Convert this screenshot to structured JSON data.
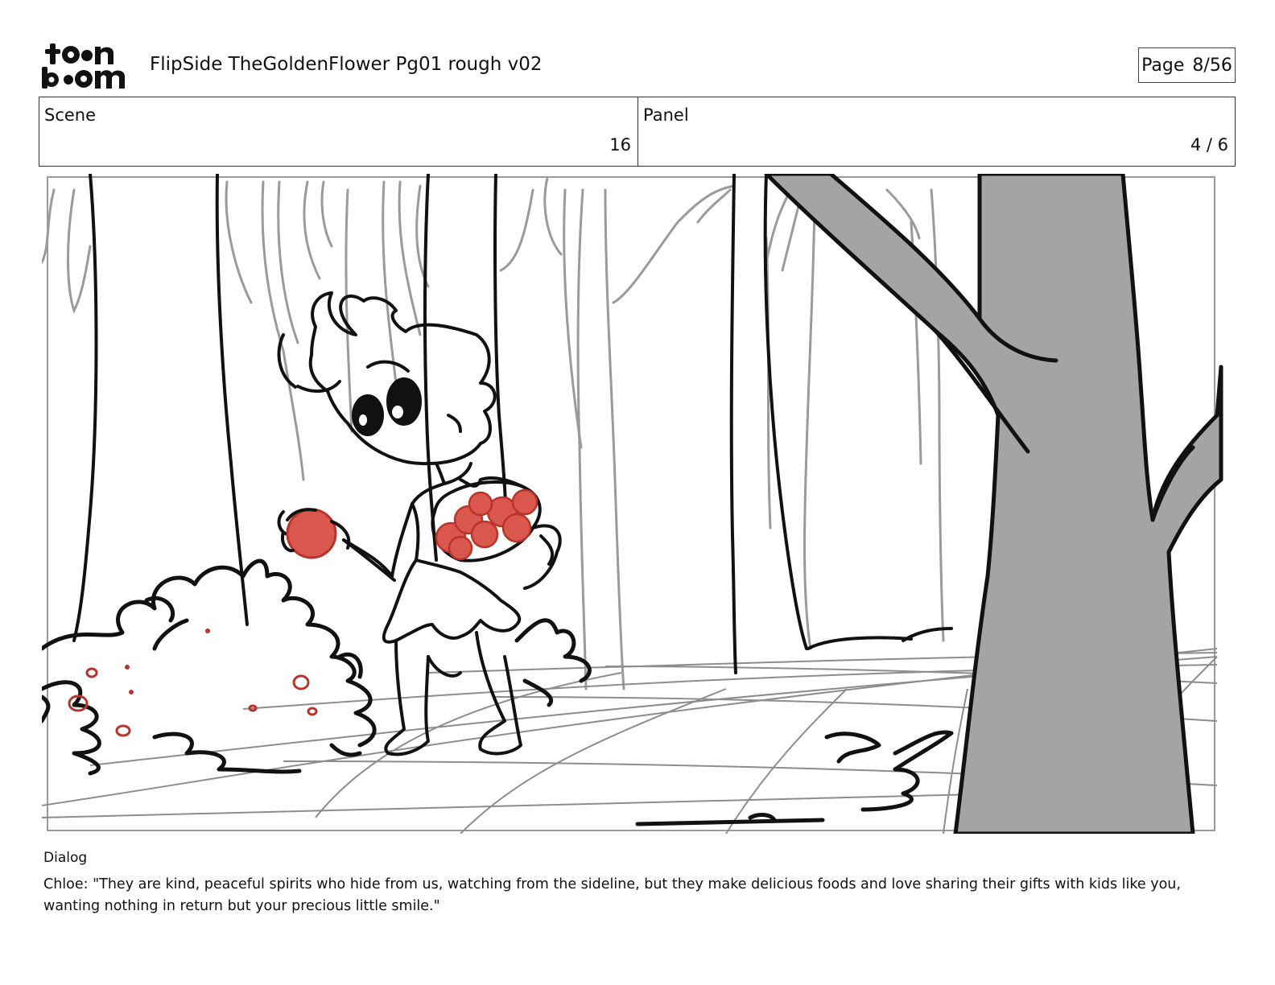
{
  "header": {
    "logo_text_top": "toon",
    "logo_text_bottom": "boom",
    "title": "FlipSide TheGoldenFlower Pg01 rough v02",
    "page_label": "Page",
    "page_value": "8/56"
  },
  "info": {
    "scene_label": "Scene",
    "scene_value": "16",
    "panel_label": "Panel",
    "panel_value": "4 / 6"
  },
  "dialog": {
    "label": "Dialog",
    "text": "Chloe: \"They are kind, peaceful spirits who hide from us, watching from the sideline, but they make delicious foods and love sharing their gifts with kids like you, wanting nothing in return but your precious little smile.\""
  },
  "colors": {
    "sketch_line": "#111111",
    "background_line": "#9a9a9a",
    "tree_fill": "#a4a4a4",
    "fruit_red": "#d9574c",
    "fruit_outline": "#b8342a"
  }
}
